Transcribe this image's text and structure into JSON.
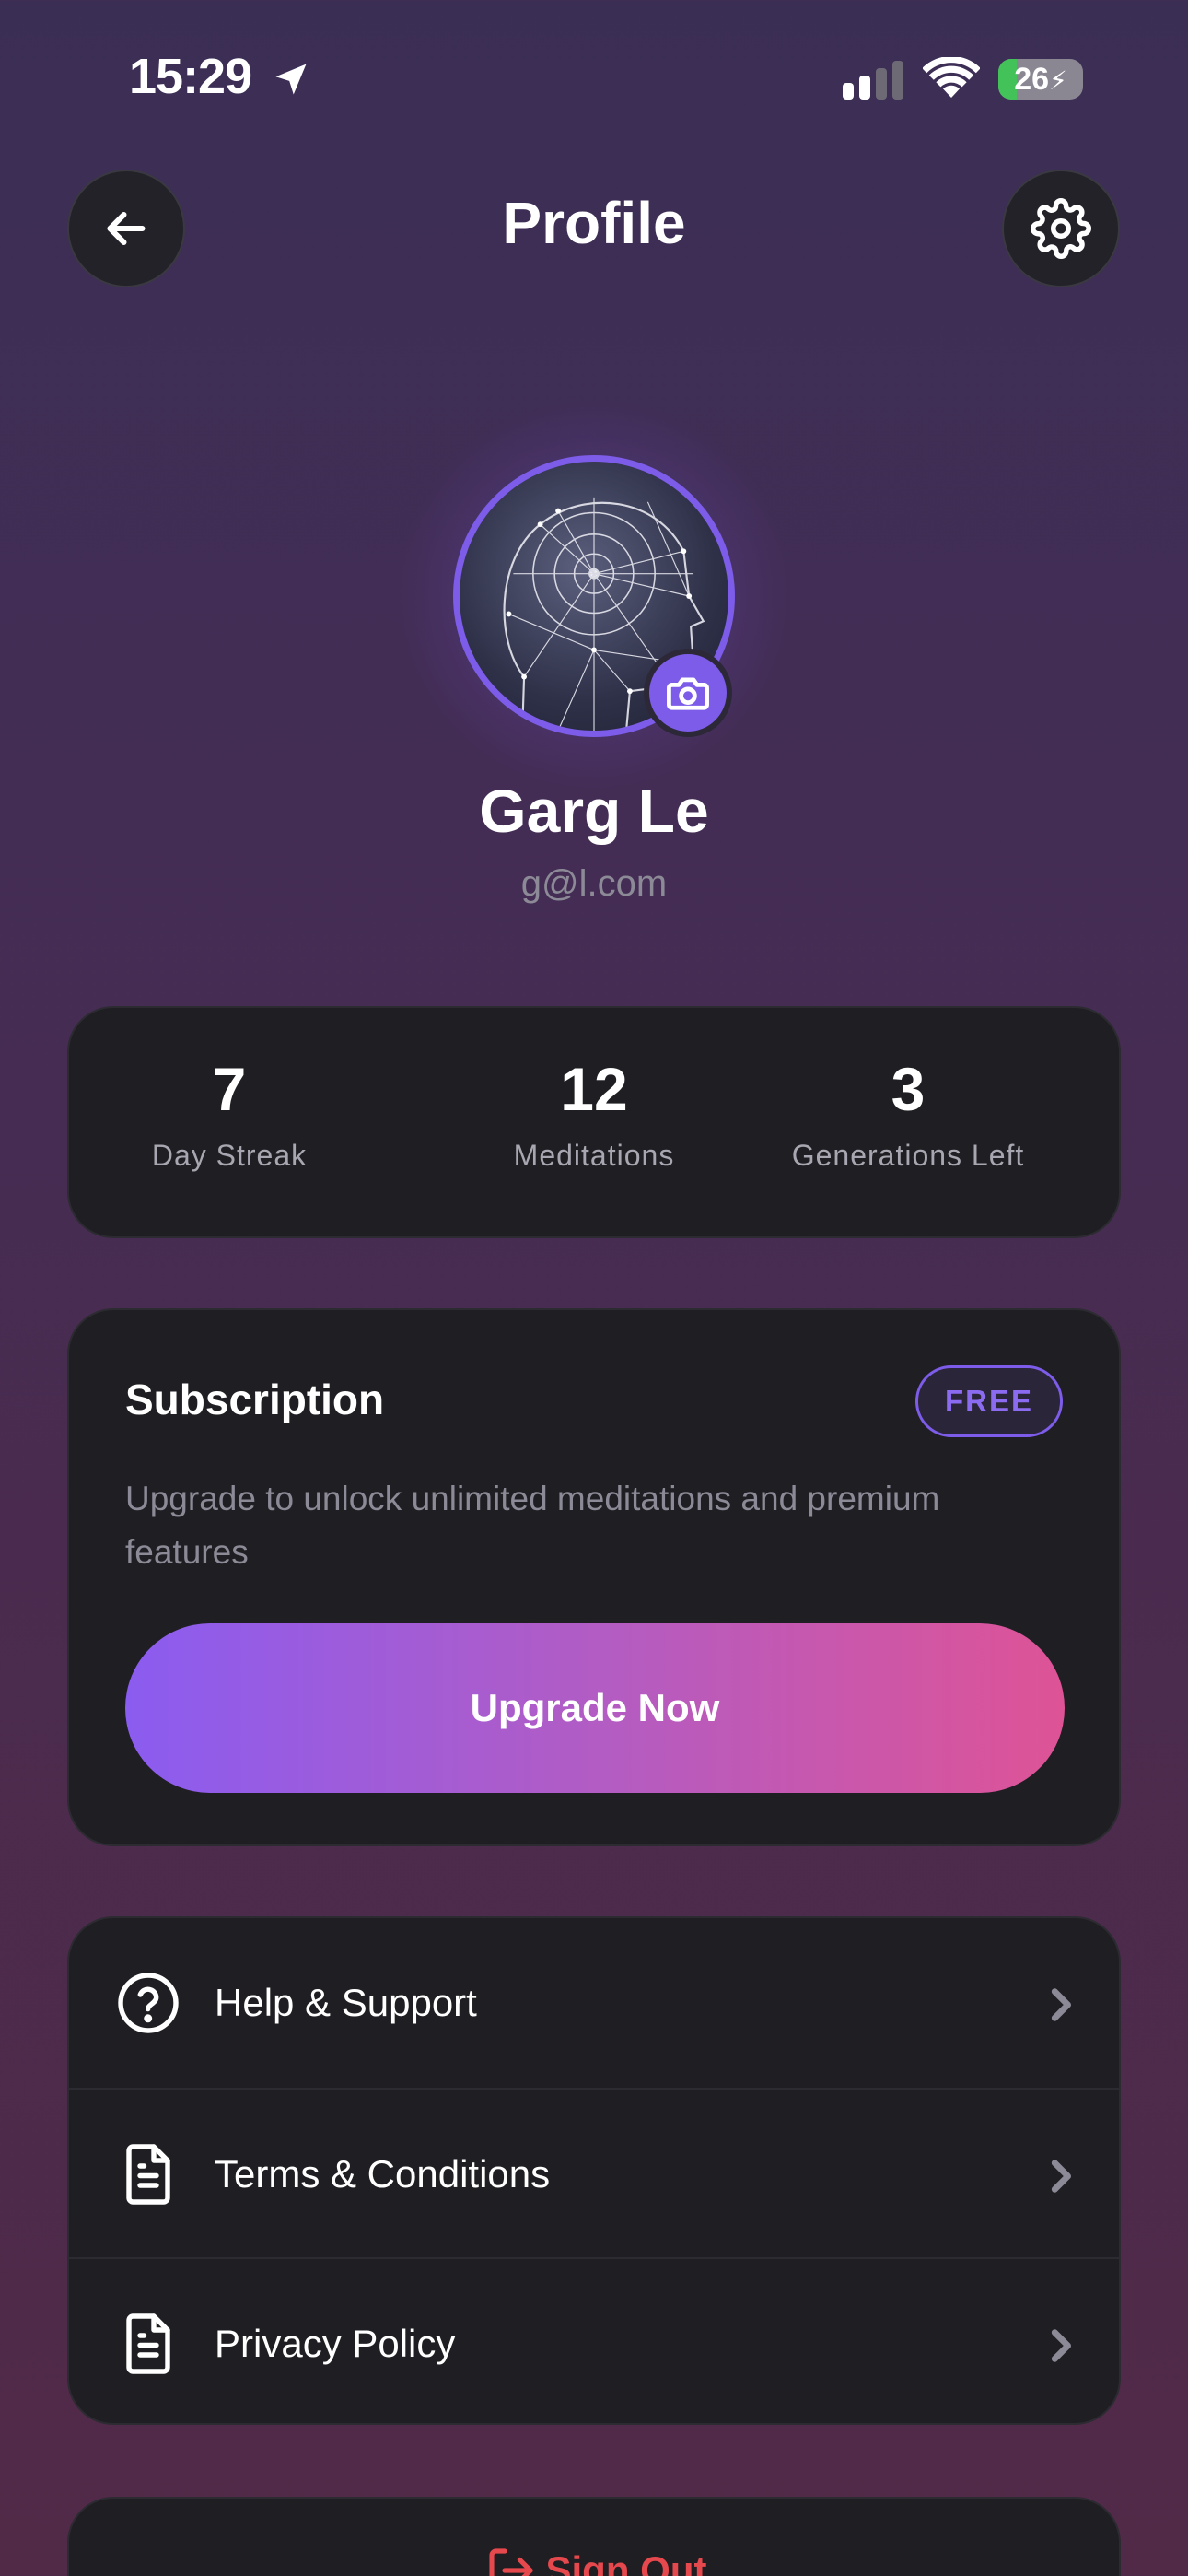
{
  "status_bar": {
    "time": "15:29",
    "battery_level": "26",
    "battery_fill_percent": 22,
    "icons": [
      "location-arrow-icon",
      "signal-icon",
      "wifi-icon",
      "battery-icon"
    ]
  },
  "header": {
    "title": "Profile",
    "back_icon": "arrow-left-icon",
    "settings_icon": "gear-icon"
  },
  "profile": {
    "name": "Garg Le",
    "email": "g@l.com",
    "avatar_icon": "wireframe-head-avatar",
    "camera_icon": "camera-icon"
  },
  "stats": [
    {
      "value": "7",
      "label": "Day Streak"
    },
    {
      "value": "12",
      "label": "Meditations"
    },
    {
      "value": "3",
      "label": "Generations Left"
    }
  ],
  "subscription": {
    "title": "Subscription",
    "badge": "FREE",
    "description": "Upgrade to unlock unlimited meditations and premium features",
    "button_label": "Upgrade Now"
  },
  "menu": {
    "items": [
      {
        "label": "Help & Support",
        "icon": "help-circle-icon"
      },
      {
        "label": "Terms & Conditions",
        "icon": "document-icon"
      },
      {
        "label": "Privacy Policy",
        "icon": "document-icon"
      }
    ]
  },
  "sign_out": {
    "label": "Sign Out",
    "icon": "sign-out-icon"
  },
  "colors": {
    "accent": "#7c5ce8",
    "gradient_start": "#8b5cf0",
    "gradient_end": "#de5396",
    "danger": "#e5484d",
    "card_bg": "#1f1e22"
  }
}
